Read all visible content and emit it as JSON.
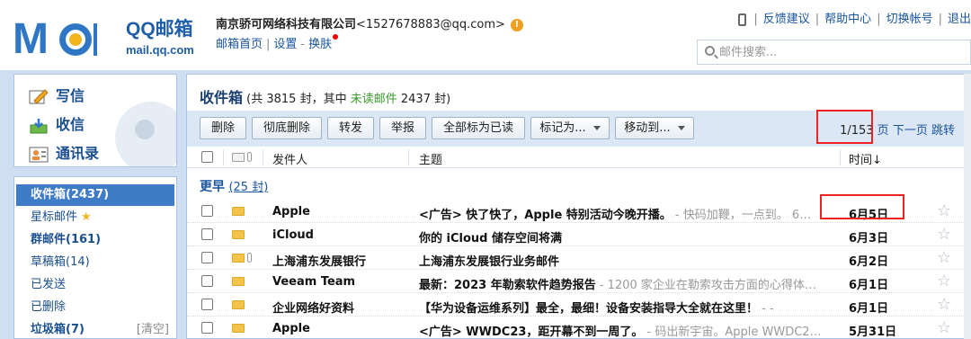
{
  "brand": {
    "logo_m": "M",
    "name": "QQ邮箱",
    "domain": "mail.qq.com"
  },
  "account": {
    "company": "南京骄可网络科技有限公司",
    "email": "<1527678883@qq.com>",
    "warn_glyph": "!"
  },
  "sublinks": [
    "邮箱首页",
    "设置",
    "换肤"
  ],
  "toplinks": [
    "反馈建议",
    "帮助中心",
    "切换帐号",
    "退出"
  ],
  "search": {
    "placeholder": "邮件搜索..."
  },
  "sidebar": {
    "compose": [
      "写信",
      "收信",
      "通讯录"
    ],
    "folders": [
      {
        "label": "收件箱(2437)"
      },
      {
        "label": "星标邮件",
        "star": "★"
      },
      {
        "label": "群邮件(161)"
      },
      {
        "label": "草稿箱(14)"
      },
      {
        "label": "已发送"
      },
      {
        "label": "已删除"
      },
      {
        "label": "垃圾箱(7)",
        "action": "[清空]"
      }
    ]
  },
  "inbox": {
    "title": "收件箱",
    "stats_prefix": "(共 3815 封，其中",
    "unread_label": "未读邮件",
    "stats_suffix": "2437 封)"
  },
  "toolbar": {
    "buttons": [
      "删除",
      "彻底删除",
      "转发",
      "举报",
      "全部标为已读",
      "标记为...",
      "移动到..."
    ],
    "page": "1/153",
    "page_unit": "页",
    "next": "下一页",
    "jump": "跳转"
  },
  "columns": {
    "from": "发件人",
    "subject": "主题",
    "time": "时间↓"
  },
  "group": {
    "name": "更早",
    "count": "(25 封)"
  },
  "mails": [
    {
      "from": "Apple",
      "subject": "<广告> 快了快了，Apple 特别活动今晚开播。",
      "preview": " - 快码加鞭，一点到。  6…",
      "date": "6月5日",
      "attach": false
    },
    {
      "from": "iCloud",
      "subject": "你的 iCloud 储存空间将满",
      "preview": "",
      "date": "6月3日",
      "attach": false
    },
    {
      "from": "上海浦东发展银行",
      "subject": "上海浦东发展银行业务邮件",
      "preview": "",
      "date": "6月2日",
      "attach": true
    },
    {
      "from": "Veeam Team",
      "subject": "最新：2023 年勒索软件趋势报告",
      "preview": " - 1200 家企业在勒索攻击方面的心得体…",
      "date": "6月1日",
      "attach": false
    },
    {
      "from": "企业网络好资料",
      "subject": "【华为设备运维系列】最全，最细！设备安装指导大全就在这里！",
      "preview": " - -",
      "date": "6月1日",
      "attach": false
    },
    {
      "from": "Apple",
      "subject": "<广告> WWDC23，距开幕不到一周了。",
      "preview": " - 码出新宇宙。Apple WWDC2…",
      "date": "5月31日",
      "attach": false
    }
  ],
  "star_glyph": "☆"
}
